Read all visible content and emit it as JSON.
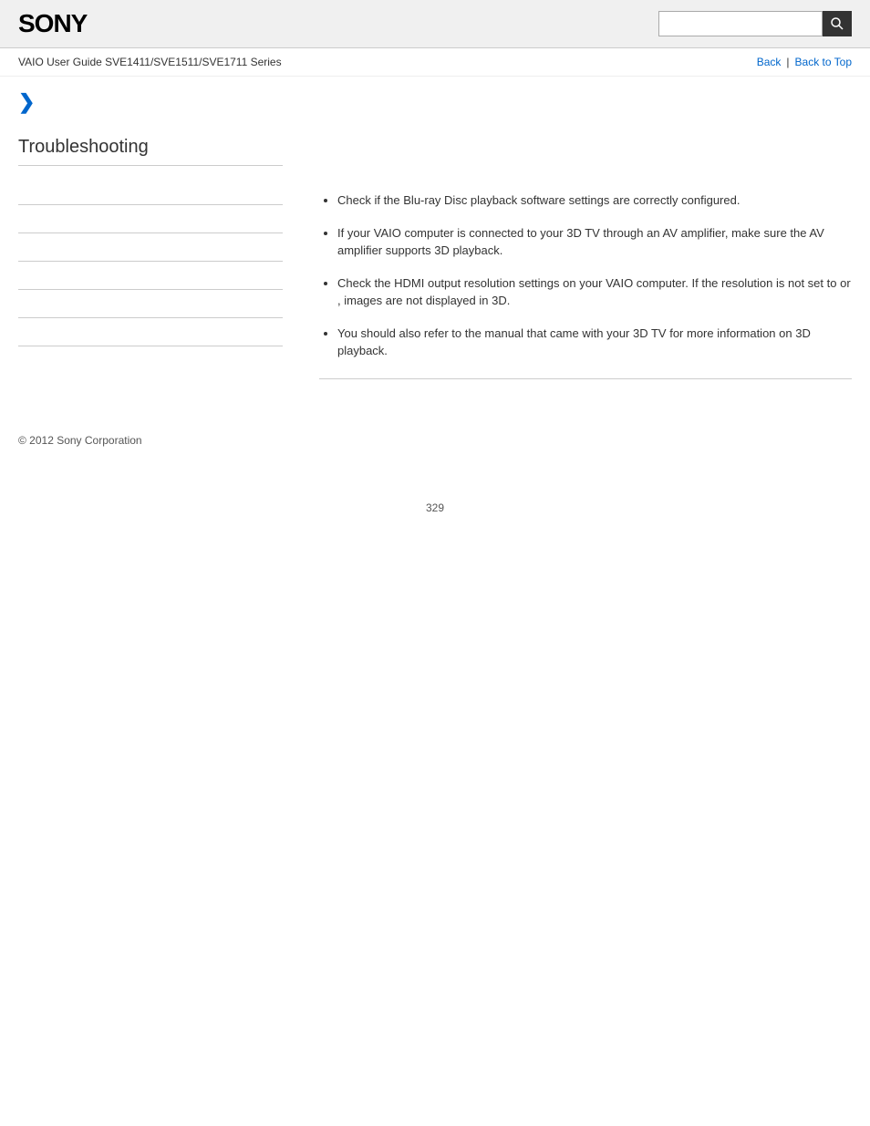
{
  "header": {
    "logo": "SONY",
    "search_placeholder": ""
  },
  "nav": {
    "title": "VAIO User Guide SVE1411/SVE1511/SVE1711 Series",
    "back_label": "Back",
    "back_to_top_label": "Back to Top",
    "separator": "|"
  },
  "breadcrumb": {
    "chevron": "❯"
  },
  "sidebar": {
    "title": "Troubleshooting",
    "items": [
      {
        "label": ""
      },
      {
        "label": ""
      },
      {
        "label": ""
      },
      {
        "label": ""
      },
      {
        "label": ""
      },
      {
        "label": ""
      }
    ]
  },
  "content": {
    "bullets": [
      "Check if the Blu-ray Disc playback software settings are correctly configured.",
      "If your VAIO computer is connected to your 3D TV through an AV amplifier, make sure the AV amplifier supports 3D playback.",
      "Check the HDMI output resolution settings on your VAIO computer. If the resolution is not set to                or               , images are not displayed in 3D.",
      "You should also refer to the manual that came with your 3D TV for more information on 3D playback."
    ]
  },
  "footer": {
    "copyright": "© 2012 Sony Corporation"
  },
  "page_number": "329",
  "icons": {
    "search": "🔍"
  }
}
